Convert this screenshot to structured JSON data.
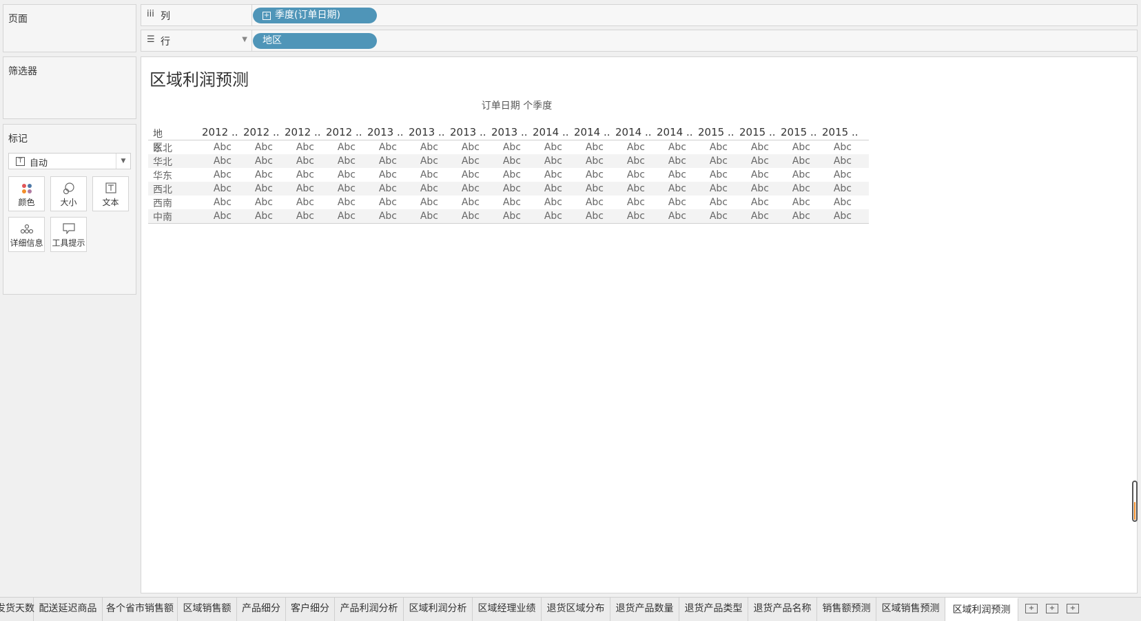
{
  "panels": {
    "pages": "页面",
    "filters": "筛选器",
    "marks": "标记"
  },
  "shelves": {
    "columns": {
      "icon": "iii",
      "label": "列",
      "pill": "季度(订单日期)",
      "pill_prefix": "⊞"
    },
    "rows": {
      "icon": "☰",
      "label": "行",
      "pill": "地区"
    }
  },
  "marks": {
    "type": "自动",
    "buttons": [
      {
        "name": "color",
        "label": "颜色"
      },
      {
        "name": "size",
        "label": "大小"
      },
      {
        "name": "text",
        "label": "文本"
      },
      {
        "name": "detail",
        "label": "详细信息"
      },
      {
        "name": "tooltip",
        "label": "工具提示"
      }
    ]
  },
  "view": {
    "title": "区域利润预测",
    "column_header": "订单日期 个季度",
    "row_header": "地区",
    "columns": [
      "2012 ..",
      "2012 ..",
      "2012 ..",
      "2012 ..",
      "2013 ..",
      "2013 ..",
      "2013 ..",
      "2013 ..",
      "2014 ..",
      "2014 ..",
      "2014 ..",
      "2014 ..",
      "2015 ..",
      "2015 ..",
      "2015 ..",
      "2015 .."
    ],
    "rows": [
      "东北",
      "华北",
      "华东",
      "西北",
      "西南",
      "中南"
    ],
    "cell_text": "Abc"
  },
  "tabs": [
    "发货天数",
    "配送延迟商品",
    "各个省市销售额",
    "区域销售额",
    "产品细分",
    "客户细分",
    "产品利润分析",
    "区域利润分析",
    "区域经理业绩",
    "退货区域分布",
    "退货产品数量",
    "退货产品类型",
    "退货产品名称",
    "销售额预测",
    "区域销售预测",
    "区域利润预测"
  ],
  "active_tab": "区域利润预测"
}
